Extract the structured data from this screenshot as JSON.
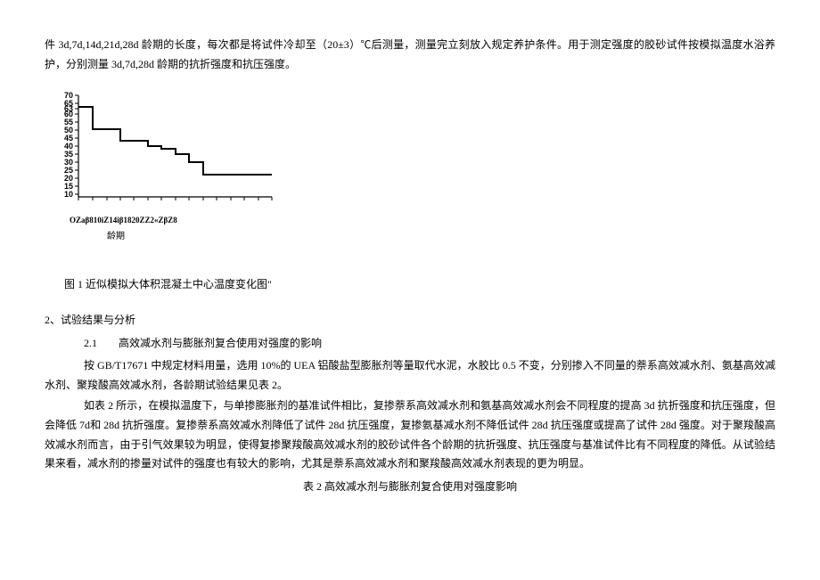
{
  "top_para": "件 3d,7d,14d,21d,28d 龄期的长度，每次都是将试件冷却至（20±3）℃后测量，测量完立刻放入规定养护条件。用于测定强度的胶砂试件按模拟温度水浴养护，分别测量 3d,7d,28d 龄期的抗折强度和抗压强度。",
  "chart_data": {
    "type": "line",
    "step": true,
    "x": [
      0,
      2,
      4,
      6,
      8,
      10,
      12,
      14,
      16,
      18,
      20,
      22,
      24,
      26,
      28
    ],
    "y": [
      63,
      63,
      50,
      50,
      43,
      43,
      40,
      38,
      35,
      30,
      23,
      23,
      23,
      23,
      23
    ],
    "y_ticks": [
      10,
      15,
      20,
      25,
      30,
      35,
      40,
      45,
      50,
      55,
      60,
      63,
      65,
      70
    ],
    "ylim": [
      10,
      70
    ],
    "xlim": [
      0,
      28
    ],
    "x_axis_raw": "OZaβ810iZ14iβ1820ZZ2«ZβZ8",
    "xlabel": "龄期",
    "title": "图 1 近似模拟大体积混凝土中心温度变化图\""
  },
  "section2": {
    "heading": "2、试验结果与分析",
    "sub": "2.1　　高效减水剂与膨胀剂复合使用对强度的影响",
    "p1": "按 GB/T17671 中规定材料用量，选用 10%的 UEA 铝酸盐型膨胀剂等量取代水泥，水胶比 0.5 不变，分别掺入不同量的萘系高效减水剂、氨基高效减水剂、聚羧酸高效减水剂，各龄期试验结果见表 2。",
    "p2": "如表 2 所示，在模拟温度下，与单掺膨胀剂的基准试件相比，复掺萘系高效减水剂和氨基高效减水剂会不同程度的提高 3d 抗折强度和抗压强度，但会降低 7d和 28d 抗折强度。复掺萘系高效减水剂降低了试件 28d 抗压强度，复掺氨基减水剂不降低试件 28d 抗压强度或提高了试件 28d 强度。对于聚羧酸高效减水剂而言，由于引气效果较为明显，使得复掺聚羧酸高效减水剂的胶砂试件各个龄期的抗折强度、抗压强度与基准试件比有不同程度的降低。从试验结果来看，减水剂的掺量对试件的强度也有较大的影响，尤其是萘系高效减水剂和聚羧酸高效减水剂表现的更为明显。",
    "table_caption": "表 2 高效减水剂与膨胀剂复合使用对强度影响"
  }
}
